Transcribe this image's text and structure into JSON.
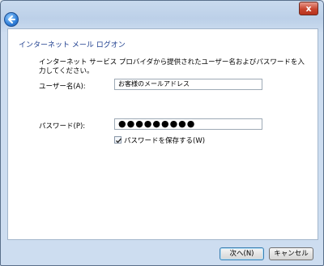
{
  "window": {
    "close_label": "x"
  },
  "page": {
    "title": "インターネット メール ログオン",
    "instructions": "インターネット サービス プロバイダから提供されたユーザー名およびパスワードを入力してください。"
  },
  "form": {
    "username_label": "ユーザー名(A):",
    "username_value": "お客様のメールアドレス",
    "password_label": "パスワード(P):",
    "password_value": "●●●●●●●●●",
    "remember_label": "パスワードを保存する(W)",
    "remember_checked": true
  },
  "buttons": {
    "next_label": "次へ(N)",
    "cancel_label": "キャンセル"
  },
  "icons": {
    "back": "back-arrow-icon",
    "check": "checkmark-icon",
    "close": "close-icon"
  }
}
